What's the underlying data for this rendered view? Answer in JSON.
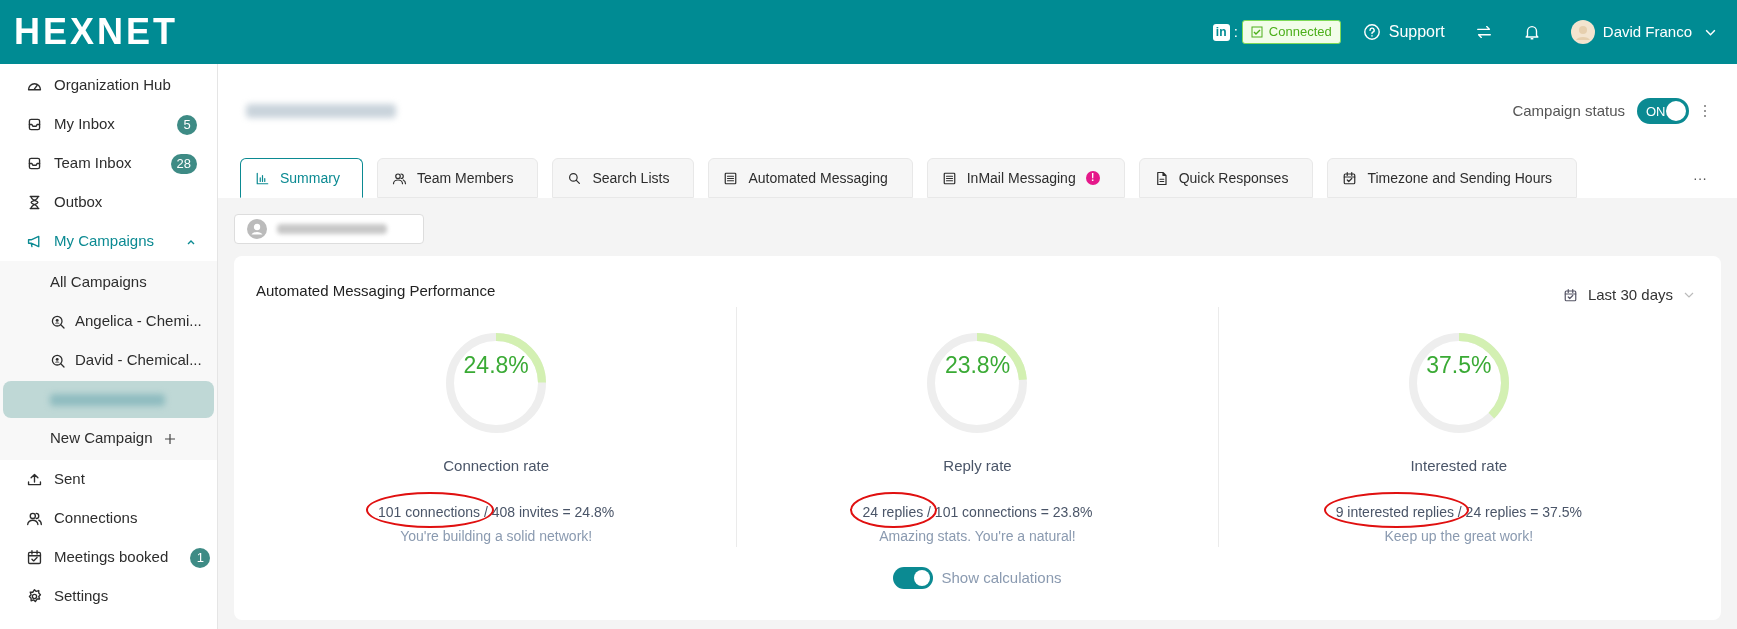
{
  "header": {
    "logo": "HEXNET",
    "linkedin": {
      "glyph": "in",
      "separator": ":",
      "status": "Connected"
    },
    "support": "Support",
    "user": "David Franco"
  },
  "sidebar": {
    "items": [
      {
        "kind": "item",
        "label": "Organization Hub",
        "selected": false
      },
      {
        "kind": "item",
        "label": "My Inbox",
        "badge": "5",
        "selected": false
      },
      {
        "kind": "item",
        "label": "Team Inbox",
        "badge": "28",
        "selected": false
      },
      {
        "kind": "item",
        "label": "Outbox",
        "selected": false
      },
      {
        "kind": "group",
        "label": "My Campaigns",
        "selected": true,
        "expanded": true,
        "children": [
          {
            "kind": "link",
            "label": "All Campaigns",
            "selected": false
          },
          {
            "kind": "campaign",
            "label": "Angelica - Chemi...",
            "selected": false
          },
          {
            "kind": "campaign",
            "label": "David - Chemical...",
            "selected": false
          },
          {
            "kind": "redacted",
            "selected": true
          },
          {
            "kind": "add",
            "label": "New Campaign",
            "selected": false
          }
        ]
      },
      {
        "kind": "item",
        "label": "Sent",
        "selected": false
      },
      {
        "kind": "item",
        "label": "Connections",
        "selected": false
      },
      {
        "kind": "item",
        "label": "Meetings booked",
        "badge": "1",
        "selected": false
      },
      {
        "kind": "item",
        "label": "Settings",
        "selected": false
      }
    ]
  },
  "campaign": {
    "status_label": "Campaign status",
    "status_on": true,
    "status_text": "ON"
  },
  "tabs": [
    {
      "label": "Summary",
      "selected": true
    },
    {
      "label": "Team Members",
      "selected": false
    },
    {
      "label": "Search Lists",
      "selected": false
    },
    {
      "label": "Automated Messaging",
      "selected": false
    },
    {
      "label": "InMail Messaging",
      "selected": false,
      "alert": "!"
    },
    {
      "label": "Quick Responses",
      "selected": false
    },
    {
      "label": "Timezone and Sending Hours",
      "selected": false
    }
  ],
  "tabs_more": "···",
  "performance": {
    "title": "Automated Messaging Performance",
    "period": "Last 30 days",
    "gauges": [
      {
        "value": "24.8%",
        "level": 0.248,
        "label": "Connection rate",
        "calculation": "101 connections / 408 invites = 24.8%",
        "circled": true,
        "comment": "You're building a solid network!"
      },
      {
        "value": "23.8%",
        "level": 0.238,
        "label": "Reply rate",
        "calculation": "24 replies / 101 connections = 23.8%",
        "circled": true,
        "comment": "Amazing stats. You're a natural!"
      },
      {
        "value": "37.5%",
        "level": 0.375,
        "label": "Interested rate",
        "calculation": "9 interested replies / 24 replies = 37.5%",
        "circled": true,
        "comment": "Keep up the great work!"
      }
    ],
    "show_calculations": {
      "on": true,
      "label": "Show calculations"
    }
  }
}
